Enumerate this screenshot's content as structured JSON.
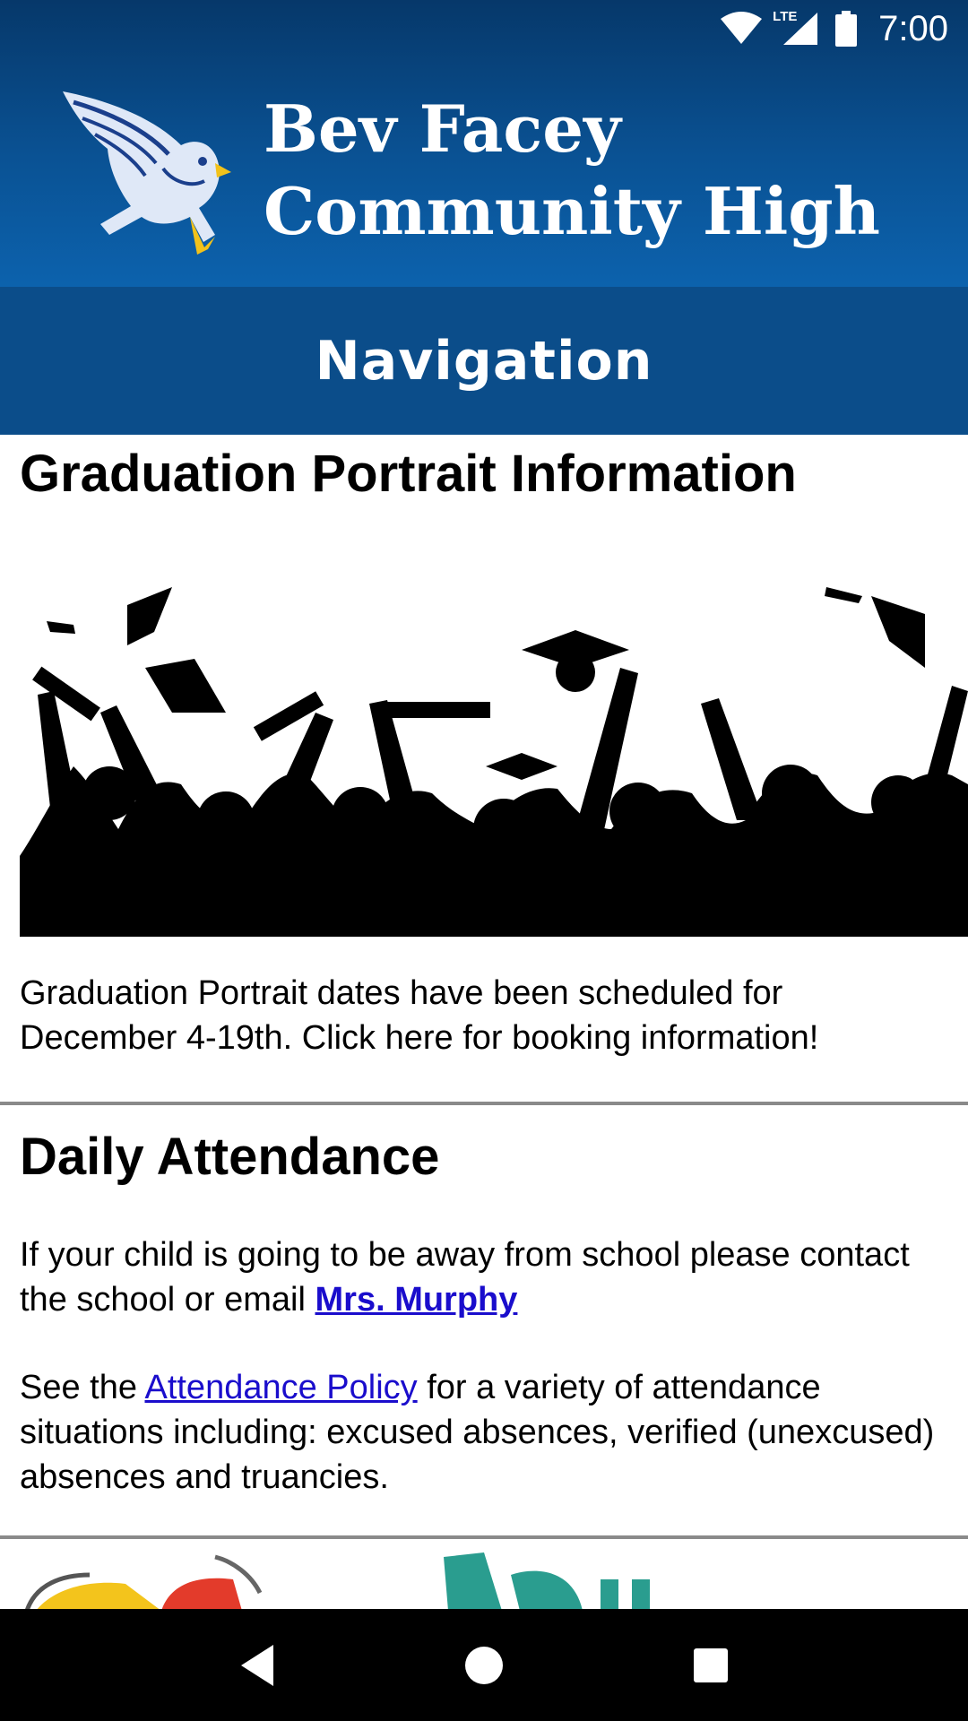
{
  "status_bar": {
    "time": "7:00",
    "network_label": "LTE",
    "icons": [
      "wifi-icon",
      "lte-signal-icon",
      "battery-icon"
    ]
  },
  "header": {
    "school_name_line1": "Bev Facey",
    "school_name_line2": "Community High",
    "logo_icon": "hawk-mascot-icon",
    "nav_title": "Navigation",
    "colors": {
      "header_top": "#06386a",
      "header_bottom": "#0c62ad",
      "nav_bar": "#0b4d8a"
    }
  },
  "sections": {
    "graduation": {
      "title": "Graduation Portrait Information",
      "image": "graduates-celebration-silhouette",
      "text": "Graduation Portrait dates have been scheduled for December 4-19th. Click here for booking information!"
    },
    "attendance": {
      "title": "Daily Attendance",
      "p1_before": "If your child is going to be away from school please contact the school or email ",
      "p1_link": "Mrs. Murphy",
      "p2_before": "See the ",
      "p2_link": "Attendance Policy",
      "p2_after": " for a variety of attendance situations including: excused absences, verified (unexcused) absences and truancies."
    }
  },
  "bottom_nav": {
    "buttons": [
      "back-icon",
      "home-icon",
      "recents-icon"
    ]
  },
  "colors": {
    "link": "#1a0dcc",
    "divider": "#8a8a8a"
  }
}
